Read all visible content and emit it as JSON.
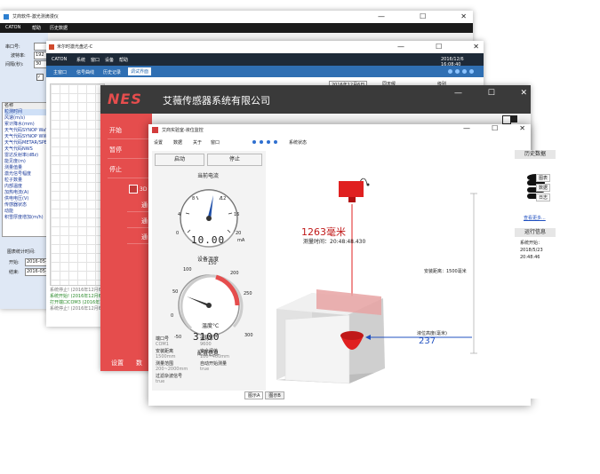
{
  "win1": {
    "title": "艾商软件-激光测滴漫仪",
    "menu": [
      "CATON",
      "帮助",
      "历史数据"
    ],
    "fields": [
      {
        "label": "串口号:",
        "value": ""
      },
      {
        "label": "波特率:",
        "value": "192"
      },
      {
        "label": "间隔(秒):",
        "value": "30"
      }
    ],
    "list_header": "名称",
    "list_items": [
      "粒测时间",
      "风速(m/s)",
      "累计降水(mm)",
      "天气代码SYNOP WaWa",
      "天气代码SYNOP WW",
      "天气代码METAR/SPECI",
      "天气代码NWS",
      "雷达反射率(dBz)",
      "能见度(m)",
      "测量值量",
      "激光信号幅度",
      "粒子数量",
      "内部温度",
      "加热电流(A)",
      "供电电压(V)",
      "传感器状态",
      "动能",
      "积雪厚度增加(m/h)"
    ],
    "time_label": "图表统计时间:",
    "start_label": "开始:",
    "start_value": "2016-05-",
    "end_label": "结束:",
    "end_value": "2016-05-"
  },
  "win2": {
    "title": "米尔时激光盘达-C",
    "menu": [
      "CATON",
      "系统",
      "窗口",
      "设备",
      "帮助"
    ],
    "datetime": "2016/12/6 16:08:40",
    "tabs": [
      "主窗口",
      "信号曲线",
      "历史记录",
      "调试界面"
    ],
    "top_right": [
      "图表",
      "调试"
    ],
    "date_field": "2016年12月6日",
    "col_header": "同天候",
    "col_header2": "级别",
    "logs": [
      {
        "text": "系统停止! (2016年12月6",
        "color": "#777777"
      },
      {
        "text": "系统开始! (2016年12月6",
        "color": "#2a8a2a"
      },
      {
        "text": "打开端口COM3 (2016年12",
        "color": "#2a8a2a"
      },
      {
        "text": "系统停止! (2016年12月6",
        "color": "#777777"
      }
    ]
  },
  "win3": {
    "logo": "NES",
    "title": "艾薇传感器系统有限公司",
    "side_buttons": [
      "开始",
      "暂停",
      "停止"
    ],
    "mode_label": "3D",
    "sub_rows": [
      "通",
      "通",
      "通"
    ],
    "bottom": [
      "设置",
      "数"
    ],
    "accent": "#e54d4d"
  },
  "win4": {
    "title": "艾商实验室-液位监控",
    "menu": [
      "设置",
      "数据",
      "关于",
      "窗口"
    ],
    "status_label": "系统状态",
    "start_btn": "启动",
    "stop_btn": "停止",
    "current_title": "当前电流",
    "current_value": "10.00",
    "current_unit": "mA",
    "gauge1_ticks": [
      "0",
      "4",
      "8",
      "12",
      "16",
      "20"
    ],
    "temp_title": "设备温度",
    "temp_label": "温度°C",
    "temp_value": "3100",
    "gauge2_ticks": [
      "-50",
      "0",
      "50",
      "100",
      "150",
      "200",
      "250",
      "300"
    ],
    "config_title": "配置信息",
    "config": [
      {
        "k": "端口号",
        "v": "COM1"
      },
      {
        "k": "波特率",
        "v": "9600"
      },
      {
        "k": "安装距离",
        "v": "1500mm"
      },
      {
        "k": "安全阈值",
        "v": "100~400mm"
      },
      {
        "k": "测量范围",
        "v": "200~2000mm"
      },
      {
        "k": "自动开始测量",
        "v": "true"
      },
      {
        "k": "过滤杂波信号",
        "v": "true"
      }
    ],
    "reading": "1263毫米",
    "measure_time": "测量时间：20:48:48.430",
    "install_distance": "安装距离：1500毫米",
    "level_label": "液位高度(毫米)",
    "level_value": "237",
    "history_title": "历史数据",
    "history_links": [
      "图表",
      "数据",
      "日志"
    ],
    "more_link": "查看更多...",
    "run_title": "运行信息",
    "run_text": "系统开始：2018/5/23 20:48:46",
    "tabs": [
      "图示A",
      "图示B"
    ]
  }
}
